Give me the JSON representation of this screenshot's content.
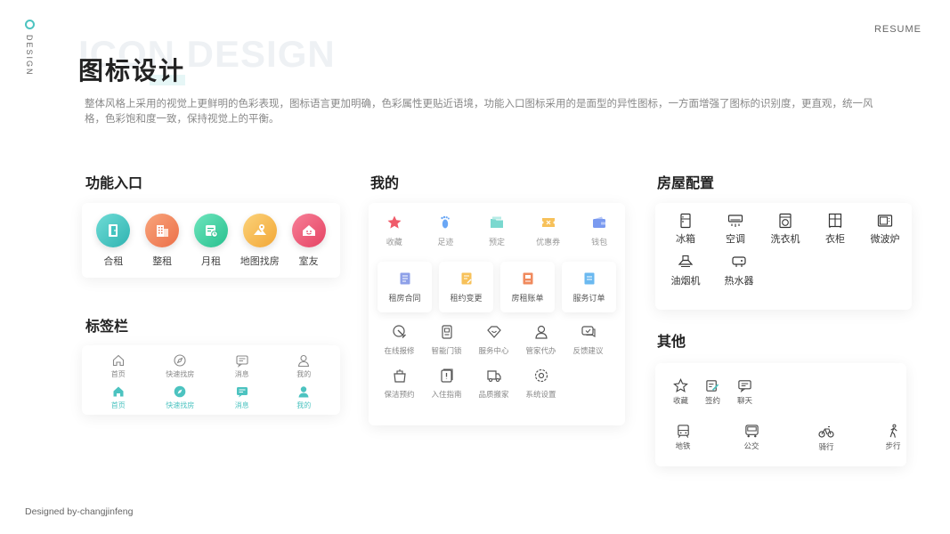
{
  "side_label": "DESIGN",
  "resume": "RESUME",
  "bg_title": "ICON DESIGN",
  "title": "图标设计",
  "description": "整体风格上采用的视觉上更鲜明的色彩表现，图标语言更加明确，色彩属性更贴近语境，功能入口图标采用的是面型的异性图标，一方面增强了图标的识别度，更直观，统一风格，色彩饱和度一致，保持视觉上的平衡。",
  "sections": {
    "functions": {
      "title": "功能入口",
      "items": [
        {
          "label": "合租",
          "icon": "door-icon",
          "color": "#43c3bf"
        },
        {
          "label": "整租",
          "icon": "building-icon",
          "color": "#f08a5d"
        },
        {
          "label": "月租",
          "icon": "calendar-clock-icon",
          "color": "#3fd0a0"
        },
        {
          "label": "地图找房",
          "icon": "map-pin-icon",
          "color": "#f7b84b"
        },
        {
          "label": "室友",
          "icon": "smile-house-icon",
          "color": "#ef5b7a"
        }
      ]
    },
    "tabbar": {
      "title": "标签栏",
      "inactive": [
        {
          "label": "首页",
          "icon": "home-icon"
        },
        {
          "label": "快速找房",
          "icon": "compass-icon"
        },
        {
          "label": "消息",
          "icon": "message-icon"
        },
        {
          "label": "我的",
          "icon": "user-icon"
        }
      ],
      "active": [
        {
          "label": "首页",
          "icon": "home-icon"
        },
        {
          "label": "快速找房",
          "icon": "compass-icon"
        },
        {
          "label": "消息",
          "icon": "message-icon"
        },
        {
          "label": "我的",
          "icon": "user-icon"
        }
      ],
      "active_color": "#4cc3c0",
      "inactive_color": "#888888"
    },
    "mine": {
      "title": "我的",
      "top_items": [
        {
          "label": "收藏",
          "icon": "star-icon",
          "color": "#ef5b6a"
        },
        {
          "label": "足迹",
          "icon": "footprint-icon",
          "color": "#6aa7f5"
        },
        {
          "label": "预定",
          "icon": "folder-icon",
          "color": "#7ad8cf"
        },
        {
          "label": "优惠券",
          "icon": "coupon-icon",
          "color": "#f7c15a"
        },
        {
          "label": "钱包",
          "icon": "wallet-icon",
          "color": "#7a9af0"
        }
      ],
      "boxes": [
        {
          "label": "租房合同",
          "icon": "contract-icon",
          "color": "#8ea0e8"
        },
        {
          "label": "租约变更",
          "icon": "lease-change-icon",
          "color": "#f7c15a"
        },
        {
          "label": "房租账单",
          "icon": "bill-icon",
          "color": "#f08a5d"
        },
        {
          "label": "服务订单",
          "icon": "order-icon",
          "color": "#6bb9f0"
        }
      ],
      "row1": [
        {
          "label": "在线报修",
          "icon": "wrench-icon"
        },
        {
          "label": "智能门锁",
          "icon": "lock-icon"
        },
        {
          "label": "服务中心",
          "icon": "diamond-heart-icon"
        },
        {
          "label": "管家代办",
          "icon": "butler-icon"
        },
        {
          "label": "反馈建议",
          "icon": "feedback-icon"
        }
      ],
      "row2": [
        {
          "label": "保洁预约",
          "icon": "cleaning-icon"
        },
        {
          "label": "入住指南",
          "icon": "guide-icon"
        },
        {
          "label": "品质搬家",
          "icon": "truck-icon"
        },
        {
          "label": "系统设置",
          "icon": "settings-icon"
        }
      ]
    },
    "house": {
      "title": "房屋配置",
      "row1": [
        {
          "label": "冰箱",
          "icon": "fridge-icon"
        },
        {
          "label": "空调",
          "icon": "air-conditioner-icon"
        },
        {
          "label": "洗衣机",
          "icon": "washing-machine-icon"
        },
        {
          "label": "衣柜",
          "icon": "wardrobe-icon"
        },
        {
          "label": "微波炉",
          "icon": "microwave-icon"
        }
      ],
      "row2": [
        {
          "label": "油烟机",
          "icon": "range-hood-icon"
        },
        {
          "label": "热水器",
          "icon": "water-heater-icon"
        }
      ]
    },
    "other": {
      "title": "其他",
      "row1": [
        {
          "label": "收藏",
          "icon": "star-outline-icon"
        },
        {
          "label": "签约",
          "icon": "sign-icon"
        },
        {
          "label": "聊天",
          "icon": "chat-icon"
        }
      ],
      "row2": [
        {
          "label": "地铁",
          "icon": "subway-icon"
        },
        {
          "label": "公交",
          "icon": "bus-icon"
        },
        {
          "label": "骑行",
          "icon": "bicycle-icon"
        },
        {
          "label": "步行",
          "icon": "walk-icon"
        }
      ]
    }
  },
  "footer": "Designed by-changjinfeng"
}
